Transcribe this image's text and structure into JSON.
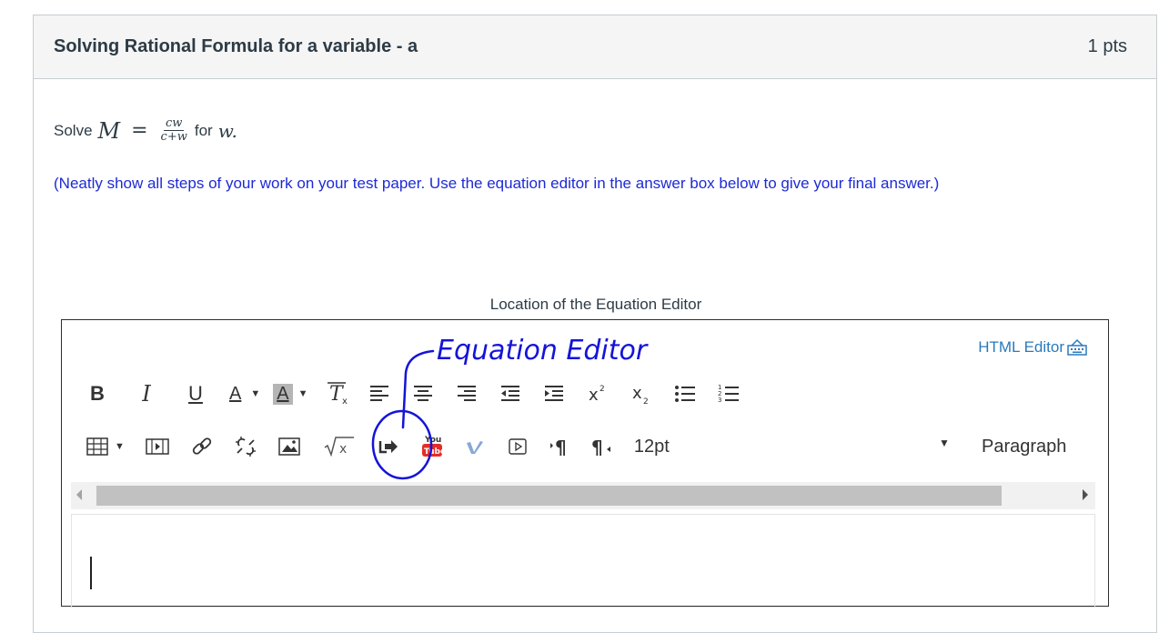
{
  "question": {
    "title": "Solving Rational Formula for a variable - a",
    "points": "1 pts",
    "prompt": {
      "solve_label": "Solve",
      "lhs": "M",
      "equals": "=",
      "numerator": "cw",
      "denominator": "c+w",
      "for_label": "for",
      "variable": "w",
      "period": "."
    },
    "instructions": "(Neatly show all steps of your work on your test paper. Use the equation editor in the answer box below to give your final answer.)"
  },
  "editor": {
    "caption": "Location of the Equation Editor",
    "html_editor_label": "HTML Editor",
    "font_size": "12pt",
    "block_format": "Paragraph",
    "toolbar_row1": [
      "bold-icon",
      "italic-icon",
      "underline-icon",
      "text-color-icon",
      "background-color-icon",
      "clear-formatting-icon",
      "align-left-icon",
      "align-center-icon",
      "align-right-icon",
      "outdent-icon",
      "indent-icon",
      "superscript-icon",
      "subscript-icon",
      "bullet-list-icon",
      "numbered-list-icon"
    ],
    "toolbar_row2": [
      "table-icon",
      "media-icon",
      "link-icon",
      "unlink-icon",
      "image-icon",
      "equation-icon",
      "lti-tool-icon",
      "youtube-icon",
      "vimeo-icon",
      "video-play-icon",
      "ltr-paragraph-icon",
      "rtl-paragraph-icon"
    ]
  },
  "annotation": {
    "text": "Equation Editor",
    "color": "#1414d8"
  },
  "colors": {
    "instructions": "#1d2ad6",
    "link": "#2b7abc",
    "header_bg": "#f5f5f5"
  }
}
